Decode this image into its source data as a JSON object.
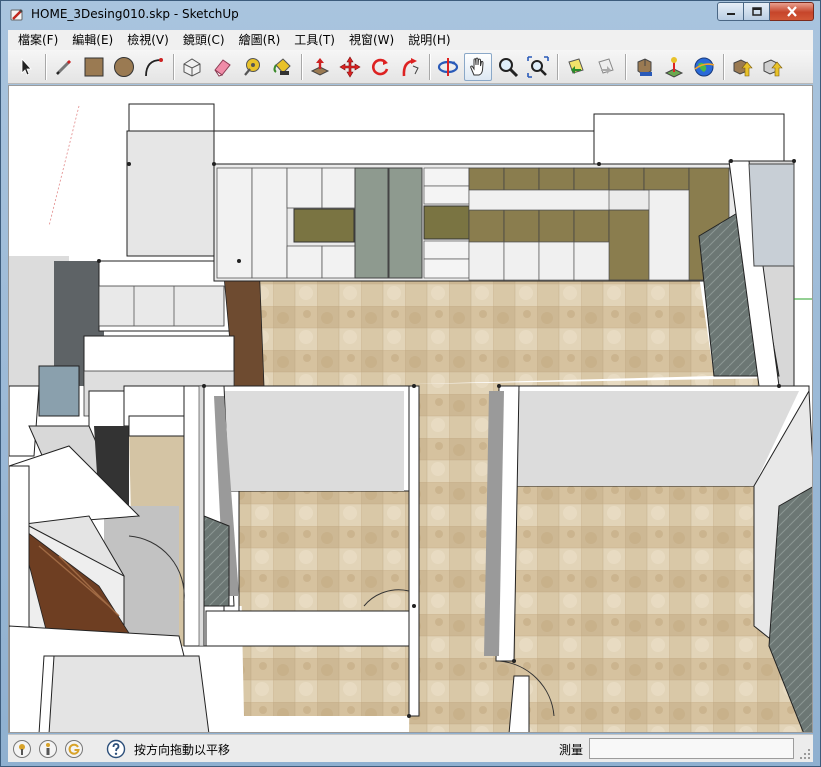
{
  "window": {
    "title": "HOME_3Desing010.skp - SketchUp"
  },
  "menu": {
    "items": [
      "檔案(F)",
      "編輯(E)",
      "檢視(V)",
      "鏡頭(C)",
      "繪圖(R)",
      "工具(T)",
      "視窗(W)",
      "說明(H)"
    ]
  },
  "toolbar": {
    "tools": [
      {
        "icon": "select-arrow-icon"
      },
      {
        "icon": "pencil-line-icon"
      },
      {
        "icon": "rectangle-icon"
      },
      {
        "icon": "circle-icon"
      },
      {
        "icon": "arc-icon"
      },
      {
        "icon": "make-component-icon"
      },
      {
        "icon": "eraser-icon"
      },
      {
        "icon": "tape-measure-icon"
      },
      {
        "icon": "paint-bucket-icon"
      },
      {
        "icon": "push-pull-icon"
      },
      {
        "icon": "move-icon"
      },
      {
        "icon": "rotate-icon"
      },
      {
        "icon": "follow-me-icon"
      },
      {
        "icon": "orbit-icon"
      },
      {
        "icon": "pan-hand-icon"
      },
      {
        "icon": "zoom-icon"
      },
      {
        "icon": "zoom-extents-icon"
      },
      {
        "icon": "previous-view-icon"
      },
      {
        "icon": "next-view-icon"
      },
      {
        "icon": "get-models-icon"
      },
      {
        "icon": "add-location-icon"
      },
      {
        "icon": "google-earth-icon"
      },
      {
        "icon": "share-model-icon"
      },
      {
        "icon": "share-component-icon"
      }
    ]
  },
  "status": {
    "hint": "按方向拖動以平移",
    "measure_label": "測量",
    "measure_value": ""
  },
  "colors": {
    "accent_close": "#c6452a",
    "floor_tile": "#d8c6a4",
    "wall_white": "#ffffff",
    "cabinet_olive": "#8a7d4e"
  }
}
